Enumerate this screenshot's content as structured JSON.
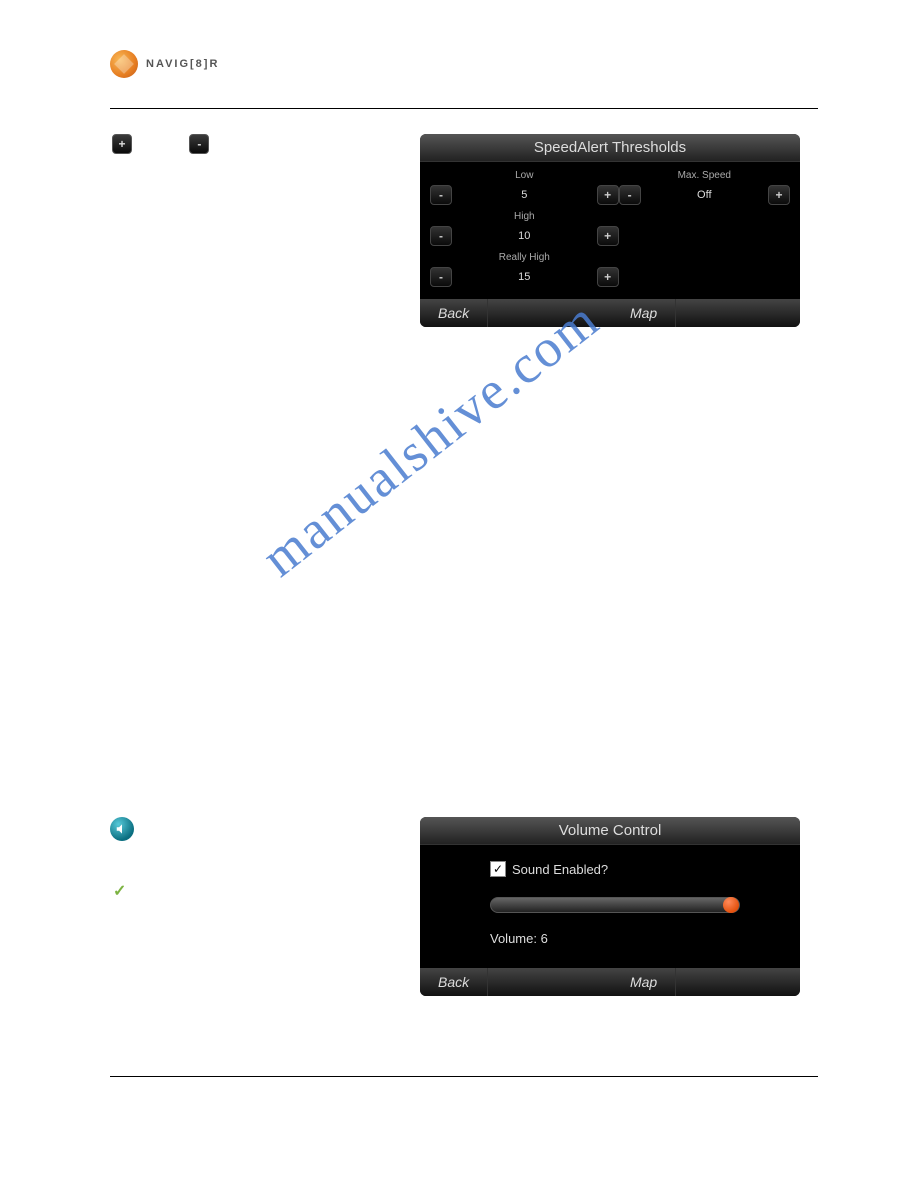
{
  "brand": {
    "name": "NAVIG[8]R"
  },
  "buttons": {
    "plus": "+",
    "minus": "-"
  },
  "screen1": {
    "title": "SpeedAlert Thresholds",
    "left": {
      "rows": [
        {
          "label": "Low",
          "value": "5"
        },
        {
          "label": "High",
          "value": "10"
        },
        {
          "label": "Really High",
          "value": "15"
        }
      ]
    },
    "right": {
      "label": "Max. Speed",
      "value": "Off"
    },
    "footer": {
      "back": "Back",
      "map": "Map"
    }
  },
  "screen2": {
    "title": "Volume Control",
    "sound_label": "Sound Enabled?",
    "volume_label": "Volume: 6",
    "footer": {
      "back": "Back",
      "map": "Map"
    }
  },
  "checkmark": "✓",
  "watermark": "manualshive.com"
}
